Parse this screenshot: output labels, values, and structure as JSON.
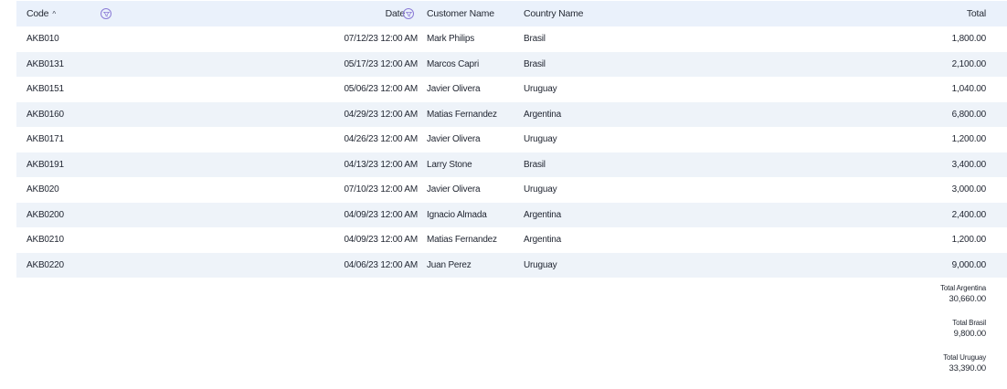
{
  "header": {
    "code_label": "Code",
    "date_label": "Date",
    "customer_label": "Customer Name",
    "country_label": "Country Name",
    "total_label": "Total"
  },
  "rows": [
    {
      "code": "AKB010",
      "date": "07/12/23 12:00 AM",
      "customer": "Mark Philips",
      "country": "Brasil",
      "total": "1,800.00"
    },
    {
      "code": "AKB0131",
      "date": "05/17/23 12:00 AM",
      "customer": "Marcos Capri",
      "country": "Brasil",
      "total": "2,100.00"
    },
    {
      "code": "AKB0151",
      "date": "05/06/23 12:00 AM",
      "customer": "Javier Olivera",
      "country": "Uruguay",
      "total": "1,040.00"
    },
    {
      "code": "AKB0160",
      "date": "04/29/23 12:00 AM",
      "customer": "Matias Fernandez",
      "country": "Argentina",
      "total": "6,800.00"
    },
    {
      "code": "AKB0171",
      "date": "04/26/23 12:00 AM",
      "customer": "Javier Olivera",
      "country": "Uruguay",
      "total": "1,200.00"
    },
    {
      "code": "AKB0191",
      "date": "04/13/23 12:00 AM",
      "customer": "Larry Stone",
      "country": "Brasil",
      "total": "3,400.00"
    },
    {
      "code": "AKB020",
      "date": "07/10/23 12:00 AM",
      "customer": "Javier Olivera",
      "country": "Uruguay",
      "total": "3,000.00"
    },
    {
      "code": "AKB0200",
      "date": "04/09/23 12:00 AM",
      "customer": "Ignacio Almada",
      "country": "Argentina",
      "total": "2,400.00"
    },
    {
      "code": "AKB0210",
      "date": "04/09/23 12:00 AM",
      "customer": "Matias Fernandez",
      "country": "Argentina",
      "total": "1,200.00"
    },
    {
      "code": "AKB0220",
      "date": "04/06/23 12:00 AM",
      "customer": "Juan Perez",
      "country": "Uruguay",
      "total": "9,000.00"
    }
  ],
  "totals": [
    {
      "label": "Total Argentina",
      "value": "30,660.00"
    },
    {
      "label": "Total Brasil",
      "value": "9,800.00"
    },
    {
      "label": "Total Uruguay",
      "value": "33,390.00"
    }
  ],
  "colors": {
    "header_bg": "#eaf1fb",
    "alt_row_bg": "#eef3f9",
    "filter_icon": "#8a7ad6"
  },
  "icons": {
    "sort": "sort-ascending-icon",
    "filter": "filter-icon"
  }
}
